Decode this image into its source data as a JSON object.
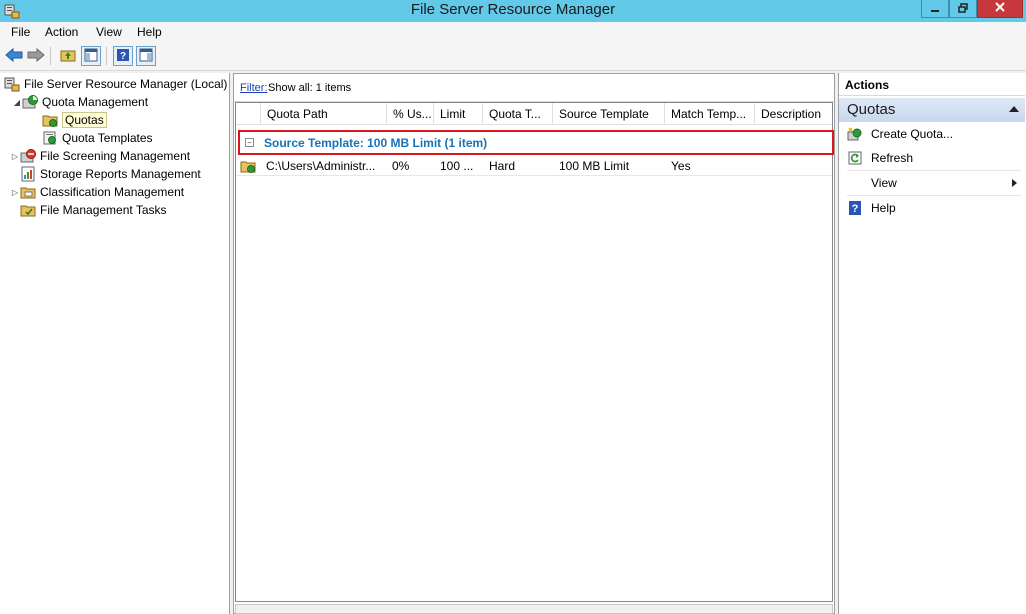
{
  "window": {
    "title": "File Server Resource Manager",
    "app_icon": "fsrm-server-icon",
    "controls": [
      "minimize-icon",
      "restore-icon",
      "close-icon"
    ]
  },
  "menu": {
    "items": [
      "File",
      "Action",
      "View",
      "Help"
    ]
  },
  "toolbar": {
    "icons": [
      "back-arrow-icon",
      "forward-arrow-icon",
      "up-folder-icon",
      "show-hide-tree-icon",
      "help-icon",
      "show-hide-action-pane-icon"
    ]
  },
  "tree": {
    "root": "File Server Resource Manager (Local)",
    "quota_management": "Quota Management",
    "quotas": "Quotas",
    "quota_templates": "Quota Templates",
    "file_screening": "File Screening Management",
    "storage_reports": "Storage Reports Management",
    "classification": "Classification Management",
    "file_management_tasks": "File Management Tasks"
  },
  "filter": {
    "link": "Filter:",
    "text": "Show all: 1 items"
  },
  "columns": [
    "Quota Path",
    "% Us...",
    "Limit",
    "Quota T...",
    "Source Template",
    "Match Temp...",
    "Description"
  ],
  "group": {
    "label": "Source Template: 100 MB Limit (1 item)",
    "toggle": "−"
  },
  "rows": [
    {
      "quota_path": "C:\\Users\\Administr...",
      "percent_used": "0%",
      "limit": "100 ...",
      "quota_type": "Hard",
      "source_template": "100 MB Limit",
      "match_template": "Yes",
      "description": ""
    }
  ],
  "actions": {
    "header": "Actions",
    "section": "Quotas",
    "items": [
      "Create Quota...",
      "Refresh",
      "View",
      "Help"
    ]
  },
  "colors": {
    "titlebar": "#62c9e8",
    "close_button": "#c7383c",
    "group_text": "#1a72b8",
    "highlight_border": "#d9171c",
    "link": "#1a44b3"
  }
}
